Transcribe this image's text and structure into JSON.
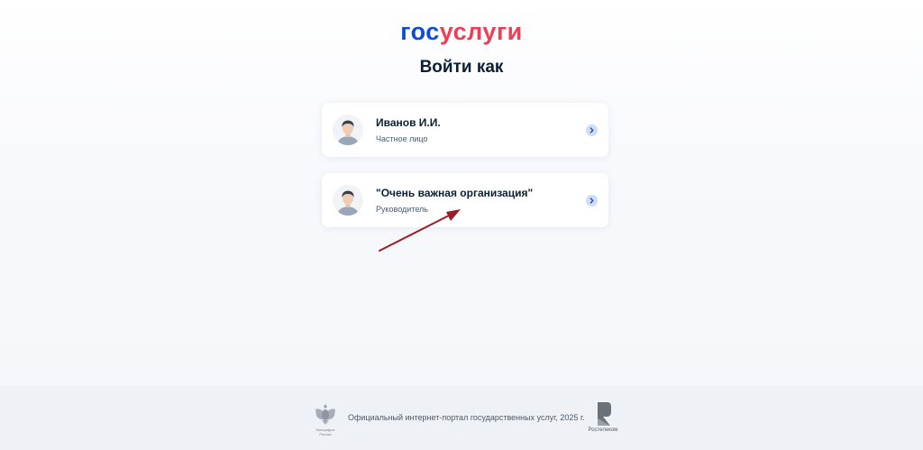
{
  "logo": {
    "part1": "гос",
    "part2": "услуги"
  },
  "title": "Войти как",
  "accounts": [
    {
      "name": "Иванов И.И.",
      "role": "Частное лицо"
    },
    {
      "name": "\"Очень важная организация\"",
      "role": "Руководитель"
    }
  ],
  "footer": {
    "text": "Официальный интернет-портал государственных услуг, 2025 г.",
    "emblem_caption_1": "Минцифры",
    "emblem_caption_2": "России",
    "partner": "Ростелеком"
  },
  "colors": {
    "brand_blue": "#0d4cd3",
    "brand_red": "#ee3f58",
    "arrow": "#9b1c24"
  }
}
